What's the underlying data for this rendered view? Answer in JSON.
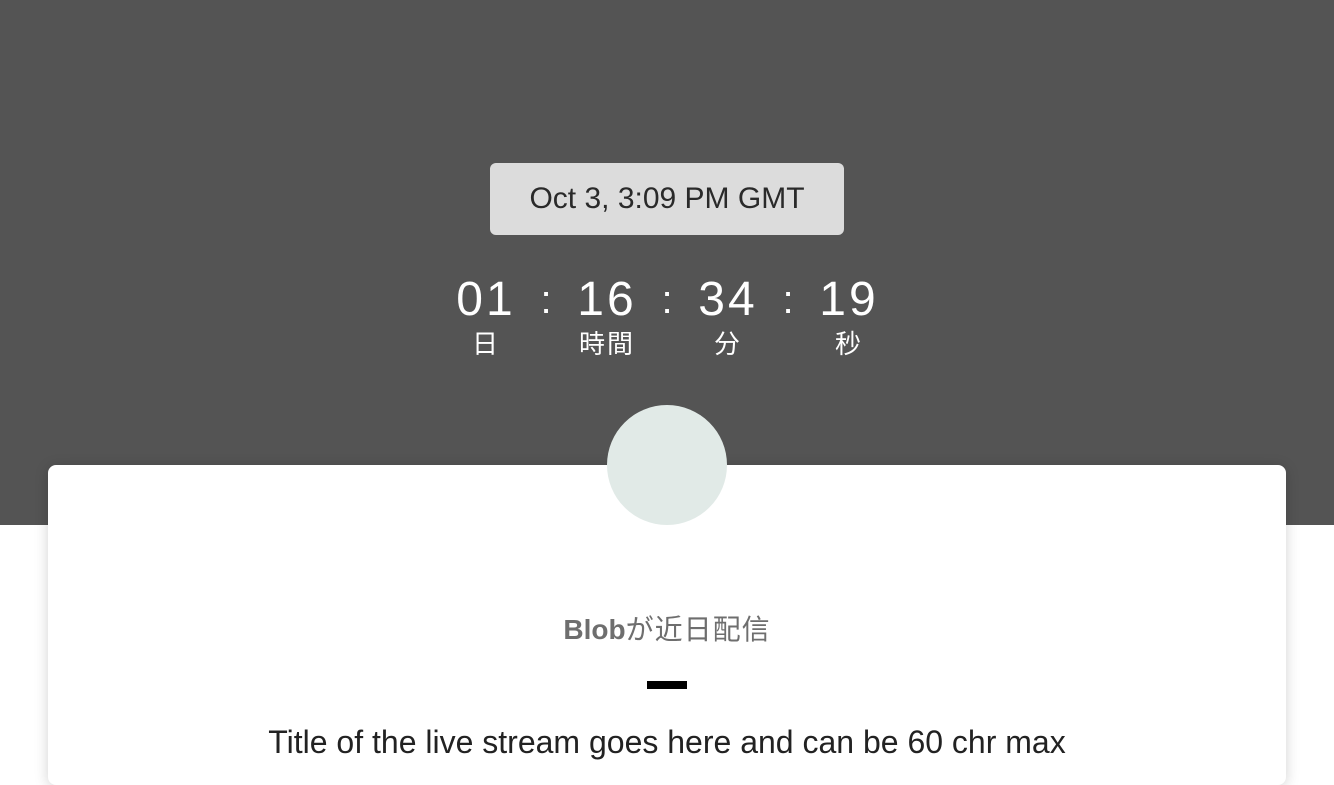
{
  "schedule": {
    "date_label": "Oct 3, 3:09 PM GMT"
  },
  "countdown": {
    "separator": ":",
    "units": [
      {
        "value": "01",
        "label": "日"
      },
      {
        "value": "16",
        "label": "時間"
      },
      {
        "value": "34",
        "label": "分"
      },
      {
        "value": "19",
        "label": "秒"
      }
    ]
  },
  "card": {
    "channel_name": "Blob",
    "channel_suffix": "が近日配信",
    "stream_title": "Title of the live stream goes here and can be 60 chr max"
  },
  "colors": {
    "hero_background": "#545454",
    "date_pill_background": "#dcdcdc",
    "avatar_background": "#e1eae7",
    "divider": "#000000"
  }
}
